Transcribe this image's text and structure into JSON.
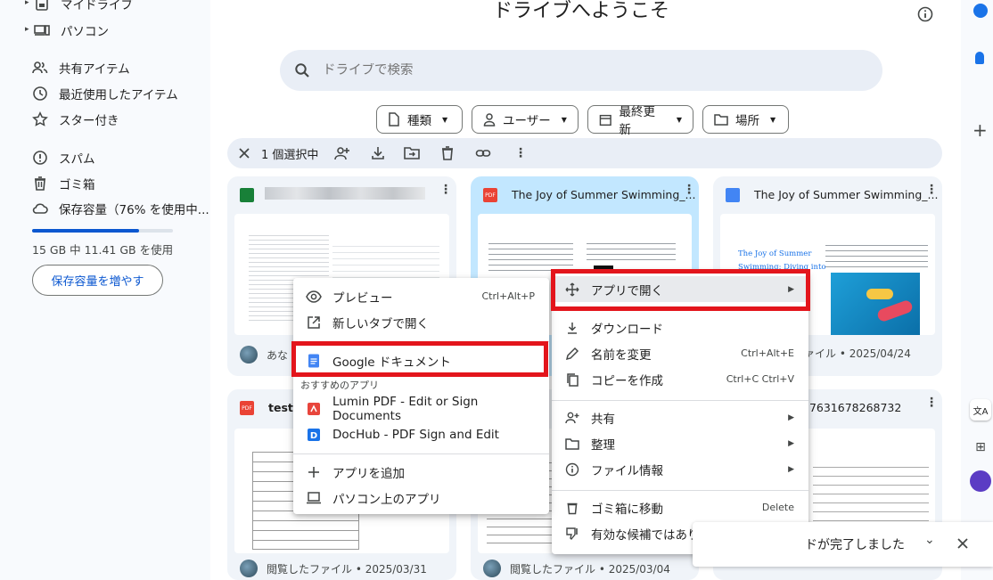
{
  "sidebar": {
    "my_drive": "マイドライブ",
    "computers": "パソコン",
    "shared": "共有アイテム",
    "recent": "最近使用したアイテム",
    "starred": "スター付き",
    "spam": "スパム",
    "trash": "ゴミ箱",
    "storage": "保存容量（76% を使用中...",
    "storage_percent": 76,
    "storage_usage": "15 GB 中 11.41 GB を使用",
    "storage_button": "保存容量を増やす"
  },
  "header": {
    "title": "ドライブへようこそ",
    "search_placeholder": "ドライブで検索"
  },
  "filters": {
    "type": "種類",
    "user": "ユーザー",
    "modified": "最終更新",
    "location": "場所"
  },
  "selection_bar": {
    "count": "1 個選択中"
  },
  "cards": {
    "c1_title": "",
    "c1_foot": "あな",
    "c2_title": "The Joy of Summer Swimming_...",
    "c3_title": "The Joy of Summer Swimming_...",
    "c3_foot": "ァイル • 2025/04/24",
    "c3_thumb_title": "The Joy of Summer Swimming: Diving into",
    "c4_title": "test.p",
    "c4_foot": "閲覧したファイル • 2025/03/31",
    "c5_foot": "閲覧したファイル • 2025/03/04",
    "c6_title": "27631678268732"
  },
  "context_menu": {
    "open_with": "アプリで開く",
    "download": "ダウンロード",
    "rename": "名前を変更",
    "rename_sc": "Ctrl+Alt+E",
    "copy": "コピーを作成",
    "copy_sc": "Ctrl+C Ctrl+V",
    "share": "共有",
    "organize": "整理",
    "file_info": "ファイル情報",
    "trash": "ゴミ箱に移動",
    "trash_sc": "Delete",
    "not_helpful": "有効な候補ではありません"
  },
  "submenu": {
    "preview": "プレビュー",
    "preview_sc": "Ctrl+Alt+P",
    "new_tab": "新しいタブで開く",
    "google_docs": "Google ドキュメント",
    "recommended": "おすすめのアプリ",
    "lumin": "Lumin PDF - Edit or Sign Documents",
    "dochub": "DocHub - PDF Sign and Edit",
    "add_app": "アプリを追加",
    "computer_apps": "パソコン上のアプリ"
  },
  "toast": {
    "text": "ドが完了しました"
  }
}
